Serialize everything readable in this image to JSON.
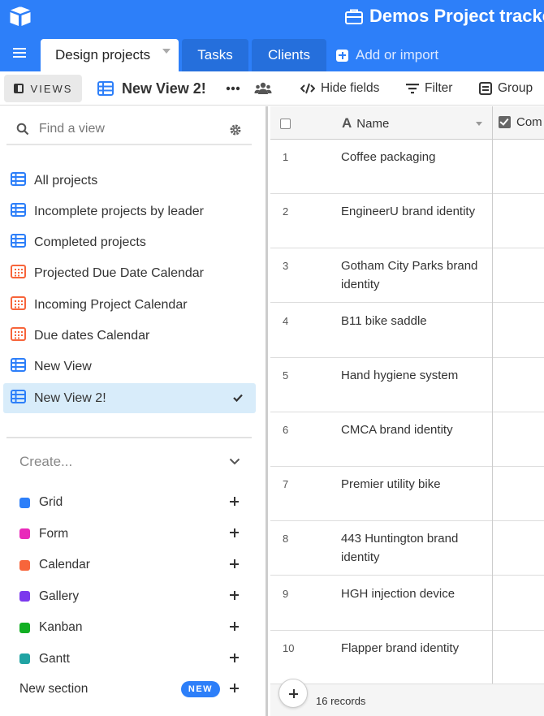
{
  "app": {
    "base_title": "Demos Project tracker",
    "brand_color": "#2d7ff9"
  },
  "tabs": [
    {
      "label": "Design projects",
      "active": true
    },
    {
      "label": "Tasks",
      "active": false
    },
    {
      "label": "Clients",
      "active": false
    }
  ],
  "add_import_label": "Add or import",
  "viewbar": {
    "views_label": "VIEWS",
    "current_view": "New View 2!",
    "hide_fields": "Hide fields",
    "filter": "Filter",
    "group": "Group"
  },
  "sidebar": {
    "search_placeholder": "Find a view",
    "views": [
      {
        "label": "All projects",
        "icon": "grid-icon"
      },
      {
        "label": "Incomplete projects by leader",
        "icon": "grid-icon"
      },
      {
        "label": "Completed projects",
        "icon": "grid-icon"
      },
      {
        "label": "Projected Due Date Calendar",
        "icon": "calendar-icon"
      },
      {
        "label": "Incoming Project Calendar",
        "icon": "calendar-icon"
      },
      {
        "label": "Due dates Calendar",
        "icon": "calendar-icon"
      },
      {
        "label": "New View",
        "icon": "grid-icon"
      },
      {
        "label": "New View 2!",
        "icon": "grid-icon",
        "selected": true
      }
    ],
    "create_label": "Create...",
    "create_items": [
      {
        "label": "Grid",
        "color": "#2d7ff9"
      },
      {
        "label": "Form",
        "color": "#e929ba"
      },
      {
        "label": "Calendar",
        "color": "#f7653b"
      },
      {
        "label": "Gallery",
        "color": "#7c39ed"
      },
      {
        "label": "Kanban",
        "color": "#11af22"
      },
      {
        "label": "Gantt",
        "color": "#20a3a3"
      }
    ],
    "new_section_label": "New section",
    "new_badge": "NEW"
  },
  "grid": {
    "columns": [
      "Name",
      "Com"
    ],
    "rows": [
      {
        "num": "1",
        "name": "Coffee packaging"
      },
      {
        "num": "2",
        "name": "EngineerU brand identity"
      },
      {
        "num": "3",
        "name": "Gotham City Parks brand identity"
      },
      {
        "num": "4",
        "name": "B11 bike saddle"
      },
      {
        "num": "5",
        "name": "Hand hygiene system"
      },
      {
        "num": "6",
        "name": "CMCA brand identity"
      },
      {
        "num": "7",
        "name": "Premier utility bike"
      },
      {
        "num": "8",
        "name": "443 Huntington brand identity"
      },
      {
        "num": "9",
        "name": "HGH injection device"
      },
      {
        "num": "10",
        "name": "Flapper brand identity"
      }
    ],
    "record_count": "16 records"
  }
}
